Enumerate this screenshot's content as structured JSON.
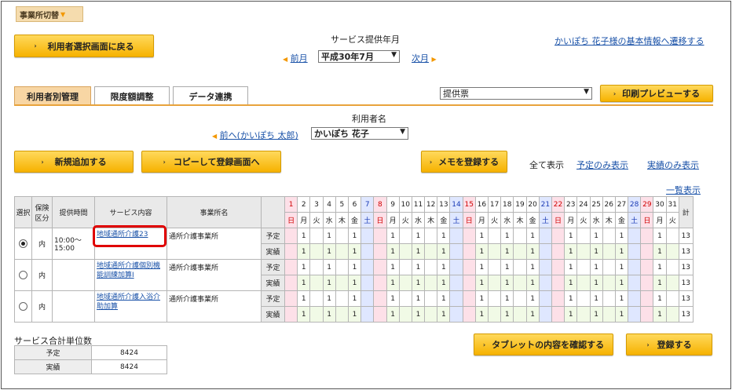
{
  "office_switch_label": "事業所切替",
  "back_button_label": "利用者選択画面に戻る",
  "service_month": {
    "title": "サービス提供年月",
    "prev_label": "前月",
    "selected": "平成30年7月",
    "next_label": "次月"
  },
  "user_info_link": "かいぽち 花子様の基本情報へ遷移する",
  "tabs": [
    {
      "label": "利用者別管理"
    },
    {
      "label": "限度額調整"
    },
    {
      "label": "データ連携"
    }
  ],
  "print_select_value": "提供票",
  "print_preview_label": "印刷プレビューする",
  "user_name": {
    "title": "利用者名",
    "prev_label": "前へ(かいぽち 太郎)",
    "selected": "かいぽち 花子"
  },
  "toolbar": {
    "new_label": "新規追加する",
    "copy_label": "コピーして登録画面へ",
    "memo_label": "メモを登録する",
    "show_all": "全て表示",
    "show_plan": "予定のみ表示",
    "show_actual": "実績のみ表示"
  },
  "list_view_link": "一覧表示",
  "table": {
    "headers": {
      "select": "選択",
      "insurance": "保険区分",
      "time": "提供時間",
      "service": "サービス内容",
      "office": "事業所名",
      "total": "計"
    },
    "days": [
      "1",
      "2",
      "3",
      "4",
      "5",
      "6",
      "7",
      "8",
      "9",
      "10",
      "11",
      "12",
      "13",
      "14",
      "15",
      "16",
      "17",
      "18",
      "19",
      "20",
      "21",
      "22",
      "23",
      "24",
      "25",
      "26",
      "27",
      "28",
      "29",
      "30",
      "31"
    ],
    "weekdays": [
      "日",
      "月",
      "火",
      "水",
      "木",
      "金",
      "土",
      "日",
      "月",
      "火",
      "水",
      "木",
      "金",
      "土",
      "日",
      "月",
      "火",
      "水",
      "木",
      "金",
      "土",
      "日",
      "月",
      "火",
      "水",
      "木",
      "金",
      "土",
      "日",
      "月",
      "火"
    ],
    "rows": [
      {
        "insurance": "内",
        "time": "10:00～\n15:00",
        "service": "地域通所介護23",
        "office": "通所介護事業所",
        "plan_label": "予定",
        "actual_label": "実績",
        "plan_total": "13",
        "actual_total": "13"
      },
      {
        "insurance": "内",
        "time": "",
        "service": "地域通所介護個別機能訓練加算Ⅰ",
        "office": "通所介護事業所",
        "plan_label": "予定",
        "actual_label": "実績",
        "plan_total": "13",
        "actual_total": "13"
      },
      {
        "insurance": "内",
        "time": "",
        "service": "地域通所介護入浴介助加算",
        "office": "通所介護事業所",
        "plan_label": "予定",
        "actual_label": "実績",
        "plan_total": "13",
        "actual_total": "13"
      }
    ],
    "cell_value": "1",
    "scheduled_days": [
      2,
      4,
      6,
      9,
      11,
      13,
      16,
      18,
      20,
      23,
      25,
      27,
      30
    ]
  },
  "summary": {
    "title": "サービス合計単位数",
    "plan_label": "予定",
    "plan_value": "8424",
    "actual_label": "実績",
    "actual_value": "8424"
  },
  "tablet_button_label": "タブレットの内容を確認する",
  "register_button_label": "登録する"
}
